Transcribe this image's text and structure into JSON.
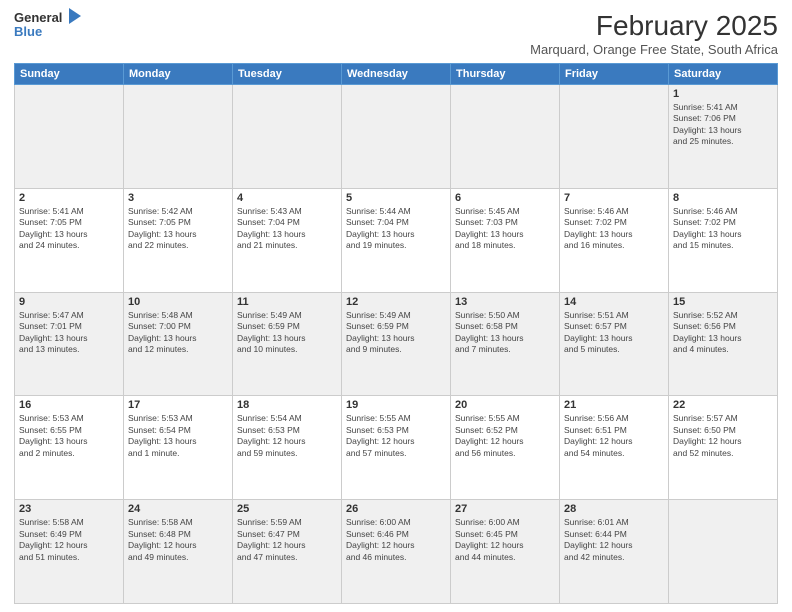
{
  "header": {
    "logo_general": "General",
    "logo_blue": "Blue",
    "month_year": "February 2025",
    "location": "Marquard, Orange Free State, South Africa"
  },
  "days_of_week": [
    "Sunday",
    "Monday",
    "Tuesday",
    "Wednesday",
    "Thursday",
    "Friday",
    "Saturday"
  ],
  "weeks": [
    [
      {
        "day": "",
        "info": ""
      },
      {
        "day": "",
        "info": ""
      },
      {
        "day": "",
        "info": ""
      },
      {
        "day": "",
        "info": ""
      },
      {
        "day": "",
        "info": ""
      },
      {
        "day": "",
        "info": ""
      },
      {
        "day": "1",
        "info": "Sunrise: 5:41 AM\nSunset: 7:06 PM\nDaylight: 13 hours\nand 25 minutes."
      }
    ],
    [
      {
        "day": "2",
        "info": "Sunrise: 5:41 AM\nSunset: 7:05 PM\nDaylight: 13 hours\nand 24 minutes."
      },
      {
        "day": "3",
        "info": "Sunrise: 5:42 AM\nSunset: 7:05 PM\nDaylight: 13 hours\nand 22 minutes."
      },
      {
        "day": "4",
        "info": "Sunrise: 5:43 AM\nSunset: 7:04 PM\nDaylight: 13 hours\nand 21 minutes."
      },
      {
        "day": "5",
        "info": "Sunrise: 5:44 AM\nSunset: 7:04 PM\nDaylight: 13 hours\nand 19 minutes."
      },
      {
        "day": "6",
        "info": "Sunrise: 5:45 AM\nSunset: 7:03 PM\nDaylight: 13 hours\nand 18 minutes."
      },
      {
        "day": "7",
        "info": "Sunrise: 5:46 AM\nSunset: 7:02 PM\nDaylight: 13 hours\nand 16 minutes."
      },
      {
        "day": "8",
        "info": "Sunrise: 5:46 AM\nSunset: 7:02 PM\nDaylight: 13 hours\nand 15 minutes."
      }
    ],
    [
      {
        "day": "9",
        "info": "Sunrise: 5:47 AM\nSunset: 7:01 PM\nDaylight: 13 hours\nand 13 minutes."
      },
      {
        "day": "10",
        "info": "Sunrise: 5:48 AM\nSunset: 7:00 PM\nDaylight: 13 hours\nand 12 minutes."
      },
      {
        "day": "11",
        "info": "Sunrise: 5:49 AM\nSunset: 6:59 PM\nDaylight: 13 hours\nand 10 minutes."
      },
      {
        "day": "12",
        "info": "Sunrise: 5:49 AM\nSunset: 6:59 PM\nDaylight: 13 hours\nand 9 minutes."
      },
      {
        "day": "13",
        "info": "Sunrise: 5:50 AM\nSunset: 6:58 PM\nDaylight: 13 hours\nand 7 minutes."
      },
      {
        "day": "14",
        "info": "Sunrise: 5:51 AM\nSunset: 6:57 PM\nDaylight: 13 hours\nand 5 minutes."
      },
      {
        "day": "15",
        "info": "Sunrise: 5:52 AM\nSunset: 6:56 PM\nDaylight: 13 hours\nand 4 minutes."
      }
    ],
    [
      {
        "day": "16",
        "info": "Sunrise: 5:53 AM\nSunset: 6:55 PM\nDaylight: 13 hours\nand 2 minutes."
      },
      {
        "day": "17",
        "info": "Sunrise: 5:53 AM\nSunset: 6:54 PM\nDaylight: 13 hours\nand 1 minute."
      },
      {
        "day": "18",
        "info": "Sunrise: 5:54 AM\nSunset: 6:53 PM\nDaylight: 12 hours\nand 59 minutes."
      },
      {
        "day": "19",
        "info": "Sunrise: 5:55 AM\nSunset: 6:53 PM\nDaylight: 12 hours\nand 57 minutes."
      },
      {
        "day": "20",
        "info": "Sunrise: 5:55 AM\nSunset: 6:52 PM\nDaylight: 12 hours\nand 56 minutes."
      },
      {
        "day": "21",
        "info": "Sunrise: 5:56 AM\nSunset: 6:51 PM\nDaylight: 12 hours\nand 54 minutes."
      },
      {
        "day": "22",
        "info": "Sunrise: 5:57 AM\nSunset: 6:50 PM\nDaylight: 12 hours\nand 52 minutes."
      }
    ],
    [
      {
        "day": "23",
        "info": "Sunrise: 5:58 AM\nSunset: 6:49 PM\nDaylight: 12 hours\nand 51 minutes."
      },
      {
        "day": "24",
        "info": "Sunrise: 5:58 AM\nSunset: 6:48 PM\nDaylight: 12 hours\nand 49 minutes."
      },
      {
        "day": "25",
        "info": "Sunrise: 5:59 AM\nSunset: 6:47 PM\nDaylight: 12 hours\nand 47 minutes."
      },
      {
        "day": "26",
        "info": "Sunrise: 6:00 AM\nSunset: 6:46 PM\nDaylight: 12 hours\nand 46 minutes."
      },
      {
        "day": "27",
        "info": "Sunrise: 6:00 AM\nSunset: 6:45 PM\nDaylight: 12 hours\nand 44 minutes."
      },
      {
        "day": "28",
        "info": "Sunrise: 6:01 AM\nSunset: 6:44 PM\nDaylight: 12 hours\nand 42 minutes."
      },
      {
        "day": "",
        "info": ""
      }
    ]
  ]
}
